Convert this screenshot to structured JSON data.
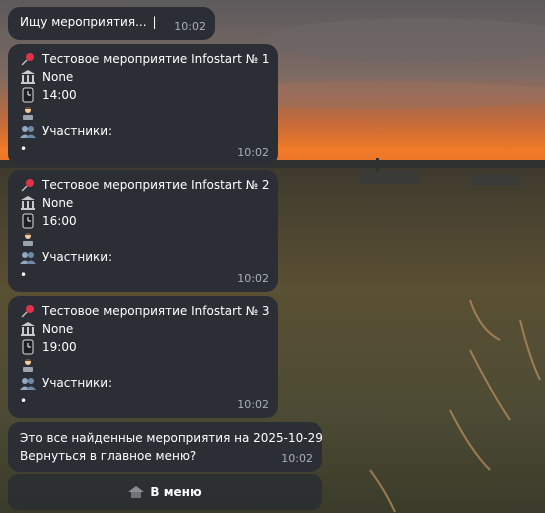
{
  "search_msg": {
    "text": "Ищу мероприятия...",
    "caret": "|",
    "time": "10:02"
  },
  "events": [
    {
      "title": "Тестовое мероприятие Infostart № 1",
      "venue": "None",
      "time_value": "14:00",
      "participants_label": "Участники:",
      "bullet": "•",
      "time": "10:02"
    },
    {
      "title": "Тестовое мероприятие Infostart № 2",
      "venue": "None",
      "time_value": "16:00",
      "participants_label": "Участники:",
      "bullet": "•",
      "time": "10:02"
    },
    {
      "title": "Тестовое мероприятие Infostart № 3",
      "venue": "None",
      "time_value": "19:00",
      "participants_label": "Участники:",
      "bullet": "•",
      "time": "10:02"
    }
  ],
  "summary": {
    "line1": "Это все найденные мероприятия на 2025-10-29",
    "line2": "Вернуться в главное меню?",
    "time": "10:02"
  },
  "menu_button": {
    "label": "В меню",
    "icon": "house-icon"
  },
  "icons": {
    "title": "pushpin-icon",
    "venue": "classical-building-icon",
    "time": "clock-icon",
    "organizer": "person-at-laptop-icon",
    "participants": "busts-icon"
  },
  "colors": {
    "bubble": "#2b2f35",
    "timestamp": "#a7b0ba",
    "pin": "#e0334b"
  }
}
